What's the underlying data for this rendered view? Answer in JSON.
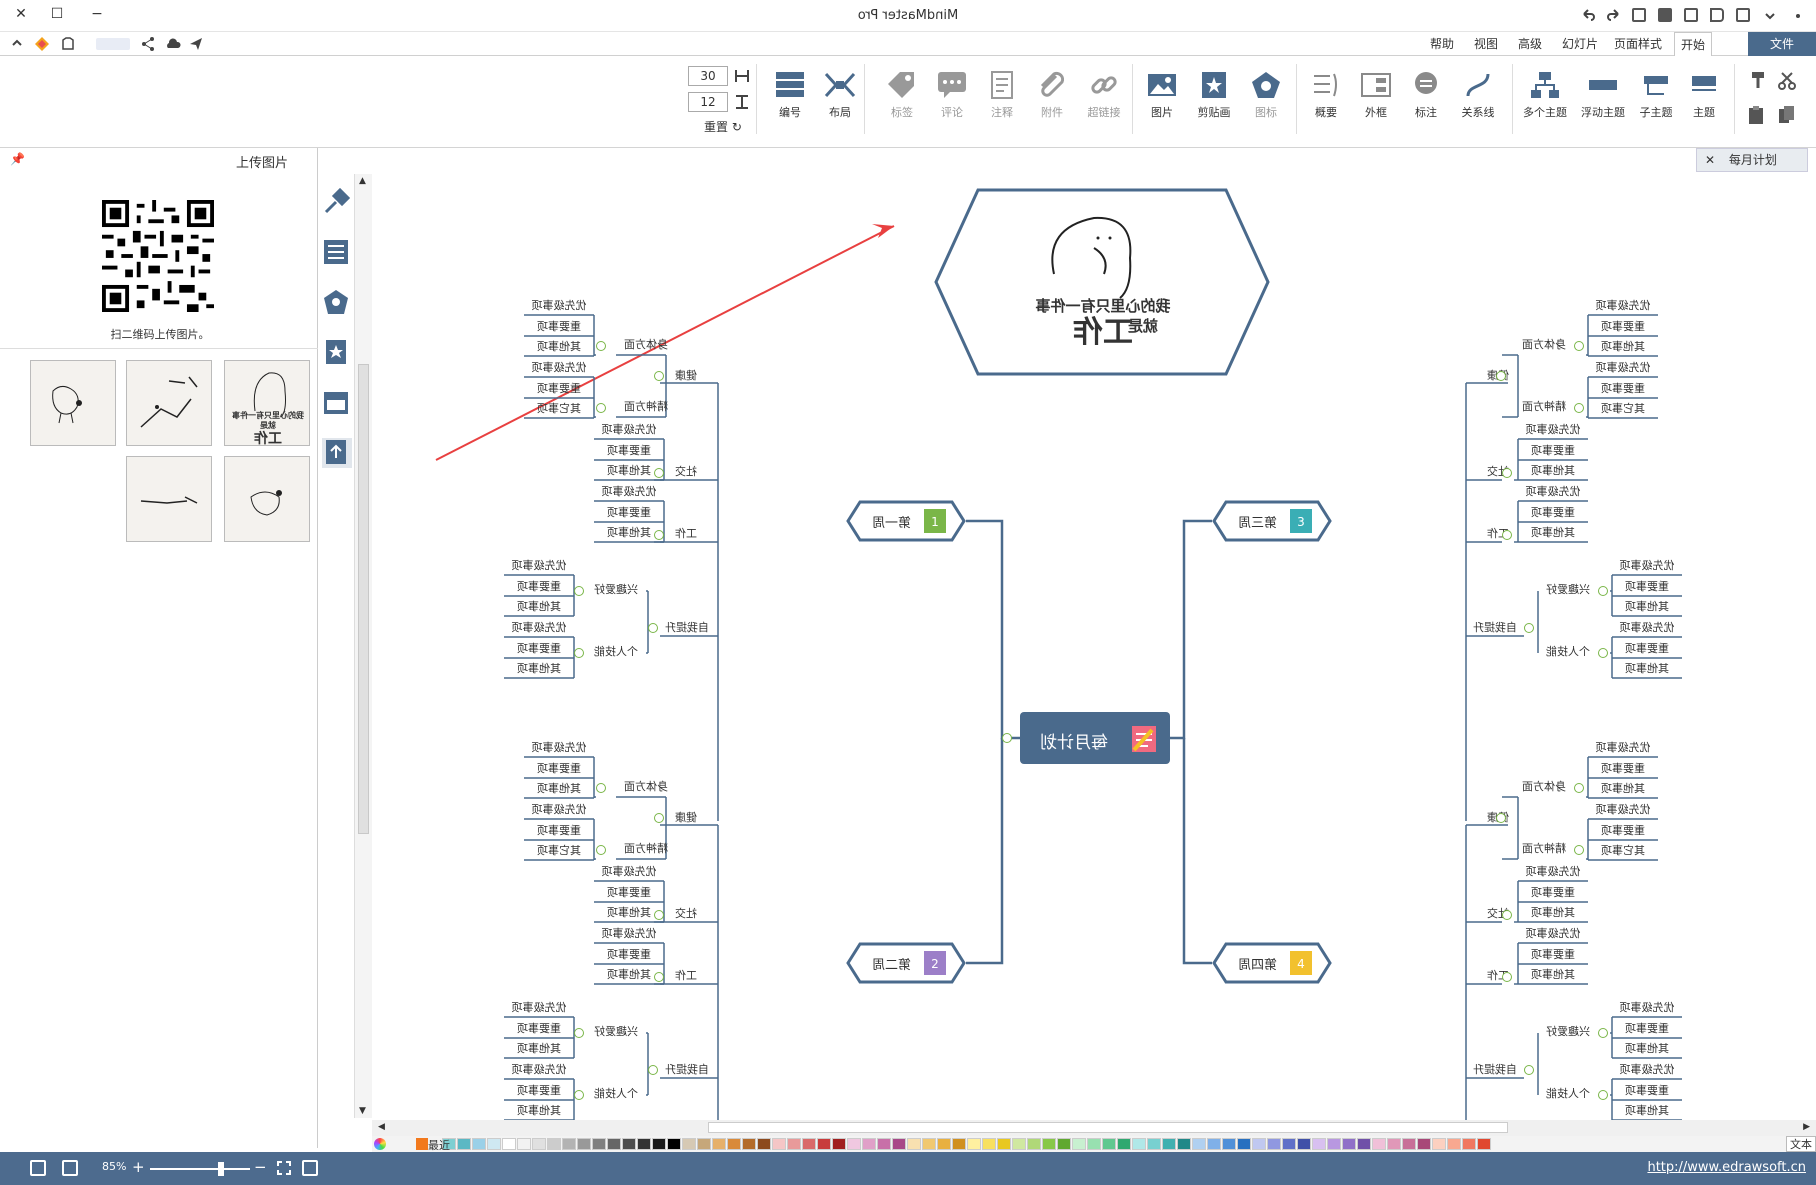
{
  "window": {
    "title": "MindMaster Pro",
    "close": "✕",
    "maximize": "☐",
    "minimize": "−"
  },
  "menu": {
    "file": "文件",
    "tabs": [
      "开始",
      "页面样式",
      "幻灯片",
      "高级",
      "视图",
      "帮助"
    ]
  },
  "ribbon": {
    "buttons": [
      {
        "label": "主题"
      },
      {
        "label": "子主题"
      },
      {
        "label": "浮动主题"
      },
      {
        "label": "多个主题"
      },
      {
        "label": "关系线"
      },
      {
        "label": "标注"
      },
      {
        "label": "外框"
      },
      {
        "label": "概要"
      },
      {
        "label": "图标"
      },
      {
        "label": "剪贴画"
      },
      {
        "label": "图片"
      },
      {
        "label": "超链接"
      },
      {
        "label": "附件"
      },
      {
        "label": "注释"
      },
      {
        "label": "评论"
      },
      {
        "label": "标签"
      },
      {
        "label": "布局"
      },
      {
        "label": "编号"
      }
    ],
    "spin1": "30",
    "spin2": "12",
    "reset": "重置"
  },
  "doc_tab": {
    "label": "每月计划",
    "close": "✕"
  },
  "left_panel": {
    "title": "上传图片",
    "qr_caption": "扫二维码上传图片。",
    "thumb_caption_line1": "我的心里只有一件事",
    "thumb_caption_line2": "就是",
    "thumb_caption_line3": "工作"
  },
  "canvas": {
    "central": "每月计划",
    "image_topic_line1": "我的心里只有一件事",
    "image_topic_line2": "就是",
    "image_topic_line3": "工作",
    "weeks": [
      {
        "label": "第一周",
        "num": "1",
        "color": "#7ab648"
      },
      {
        "label": "第二周",
        "num": "2",
        "color": "#9c7fc8"
      },
      {
        "label": "第三周",
        "num": "3",
        "color": "#3aaeb5"
      },
      {
        "label": "第四周",
        "num": "4",
        "color": "#f2c12e"
      }
    ],
    "level2": [
      "健康",
      "社交",
      "工作",
      "自我提升"
    ],
    "level3": {
      "health": [
        "身体方面",
        "精神方面"
      ],
      "self": [
        "兴趣爱好",
        "个人技能"
      ]
    },
    "leaves": [
      "优先级事项",
      "重要事项",
      "其他事项"
    ],
    "leaves_alt": [
      "优先级事项",
      "重要事项",
      "其它事项"
    ]
  },
  "palette": {
    "label": "最近",
    "end_label": "文本"
  },
  "status": {
    "zoom": "85%",
    "url": "http://www.edrawsoft.cn"
  }
}
